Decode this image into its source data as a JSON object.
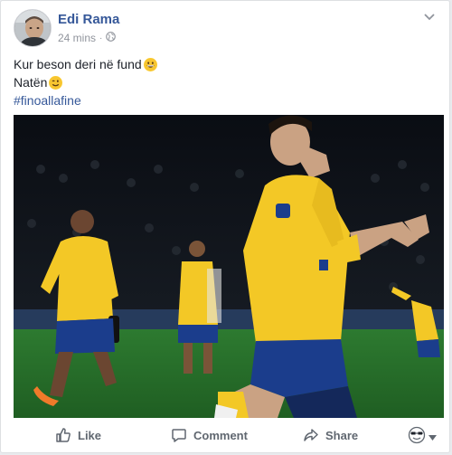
{
  "post": {
    "author": "Edi Rama",
    "time": "24 mins",
    "separator": "·",
    "privacy_icon": "globe-icon",
    "menu_icon": "chevron-down-icon",
    "text_lines": [
      "Kur beson deri në fund",
      "Natën"
    ],
    "line_emojis": [
      "grinning-face-emoji",
      "winking-face-emoji"
    ],
    "hashtag": "#finoallafine"
  },
  "photo": {
    "subject": "football-players-celebrating",
    "colors": {
      "kit_yellow": "#f3c826",
      "kit_blue": "#1b3d8c",
      "pitch": "#2f7f2f",
      "crowd": "#15191f"
    }
  },
  "actions": {
    "like_label": "Like",
    "comment_label": "Comment",
    "share_label": "Share",
    "like_icon": "thumbs-up-icon",
    "comment_icon": "comment-icon",
    "share_icon": "share-arrow-icon",
    "reaction_icon": "reaction-face-icon"
  },
  "colors": {
    "link": "#365899",
    "muted": "#90949c",
    "action": "#606770",
    "border": "#dddfe2"
  }
}
